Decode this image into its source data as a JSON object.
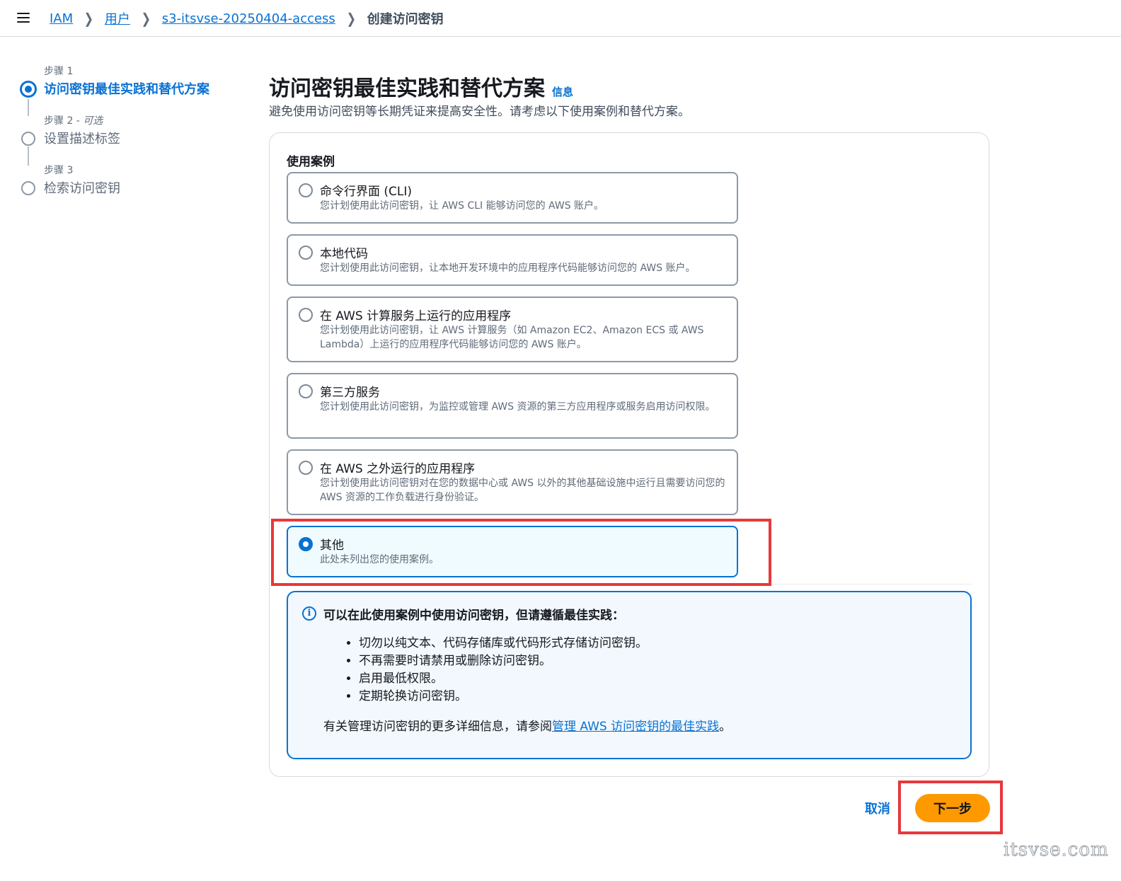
{
  "breadcrumb": {
    "items": [
      "IAM",
      "用户",
      "s3-itsvse-20250404-access"
    ],
    "current": "创建访问密钥"
  },
  "steps": [
    {
      "num": "步骤 1",
      "optional": "",
      "title": "访问密钥最佳实践和替代方案",
      "state": "active"
    },
    {
      "num": "步骤 2 - ",
      "optional": "可选",
      "title": "设置描述标签",
      "state": "inactive"
    },
    {
      "num": "步骤 3",
      "optional": "",
      "title": "检索访问密钥",
      "state": "inactive"
    }
  ],
  "page": {
    "title": "访问密钥最佳实践和替代方案",
    "info_link": "信息",
    "description": "避免使用访问密钥等长期凭证来提高安全性。请考虑以下使用案例和替代方案。"
  },
  "use_cases": {
    "label": "使用案例",
    "options": [
      {
        "title": "命令行界面 (CLI)",
        "desc": "您计划使用此访问密钥，让 AWS CLI 能够访问您的 AWS 账户。",
        "selected": false
      },
      {
        "title": "本地代码",
        "desc": "您计划使用此访问密钥，让本地开发环境中的应用程序代码能够访问您的 AWS 账户。",
        "selected": false
      },
      {
        "title": "在 AWS 计算服务上运行的应用程序",
        "desc": "您计划使用此访问密钥，让 AWS 计算服务（如 Amazon EC2、Amazon ECS 或 AWS Lambda）上运行的应用程序代码能够访问您的 AWS 账户。",
        "selected": false
      },
      {
        "title": "第三方服务",
        "desc": "您计划使用此访问密钥，为监控或管理 AWS 资源的第三方应用程序或服务启用访问权限。",
        "selected": false
      },
      {
        "title": "在 AWS 之外运行的应用程序",
        "desc": "您计划使用此访问密钥对在您的数据中心或 AWS 以外的其他基础设施中运行且需要访问您的 AWS 资源的工作负载进行身份验证。",
        "selected": false
      },
      {
        "title": "其他",
        "desc": "此处未列出您的使用案例。",
        "selected": true
      }
    ]
  },
  "alert": {
    "icon": "info-icon",
    "title": "可以在此使用案例中使用访问密钥，但请遵循最佳实践：",
    "items": [
      "切勿以纯文本、代码存储库或代码形式存储访问密钥。",
      "不再需要时请禁用或删除访问密钥。",
      "启用最低权限。",
      "定期轮换访问密钥。"
    ],
    "footer_prefix": "有关管理访问密钥的更多详细信息，请参阅",
    "footer_link": "管理 AWS 访问密钥的最佳实践",
    "footer_suffix": "。"
  },
  "actions": {
    "cancel": "取消",
    "next": "下一步"
  },
  "watermark": "itsvse.com",
  "colors": {
    "accent": "#0972d3",
    "primary_button": "#ff9900",
    "highlight": "#e8383a"
  }
}
